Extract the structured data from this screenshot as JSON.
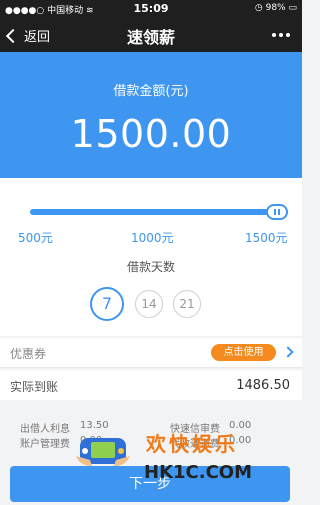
{
  "status_bar": {
    "carrier": "中国移动",
    "time": "15:09",
    "battery": "98%"
  },
  "nav": {
    "back_label": "返回",
    "title": "速领薪"
  },
  "hero": {
    "label": "借款金额(元)",
    "amount": "1500.00"
  },
  "slider": {
    "value_fraction": 1.0,
    "ticks": [
      "500元",
      "1000元",
      "1500元"
    ]
  },
  "days": {
    "label": "借款天数",
    "options": [
      "7",
      "14",
      "21"
    ],
    "selected": "7"
  },
  "coupon": {
    "label": "优惠券",
    "button": "点击使用"
  },
  "actual": {
    "label": "实际到账",
    "value": "1486.50"
  },
  "fees": {
    "interest_label": "出借人利息",
    "interest_value": "13.50",
    "review_label": "快速信审费",
    "review_value": "0.00",
    "account_label": "账户管理费",
    "account_value": "0.00",
    "channel_label": "代收通道费",
    "channel_value": "0.00"
  },
  "next_button": "下一步",
  "watermark": {
    "line1": "欢快娱乐",
    "line2": "HK1C.COM"
  },
  "colors": {
    "primary": "#3f96f0",
    "accent": "#f58a1f",
    "bar": "#1f1f1f"
  }
}
